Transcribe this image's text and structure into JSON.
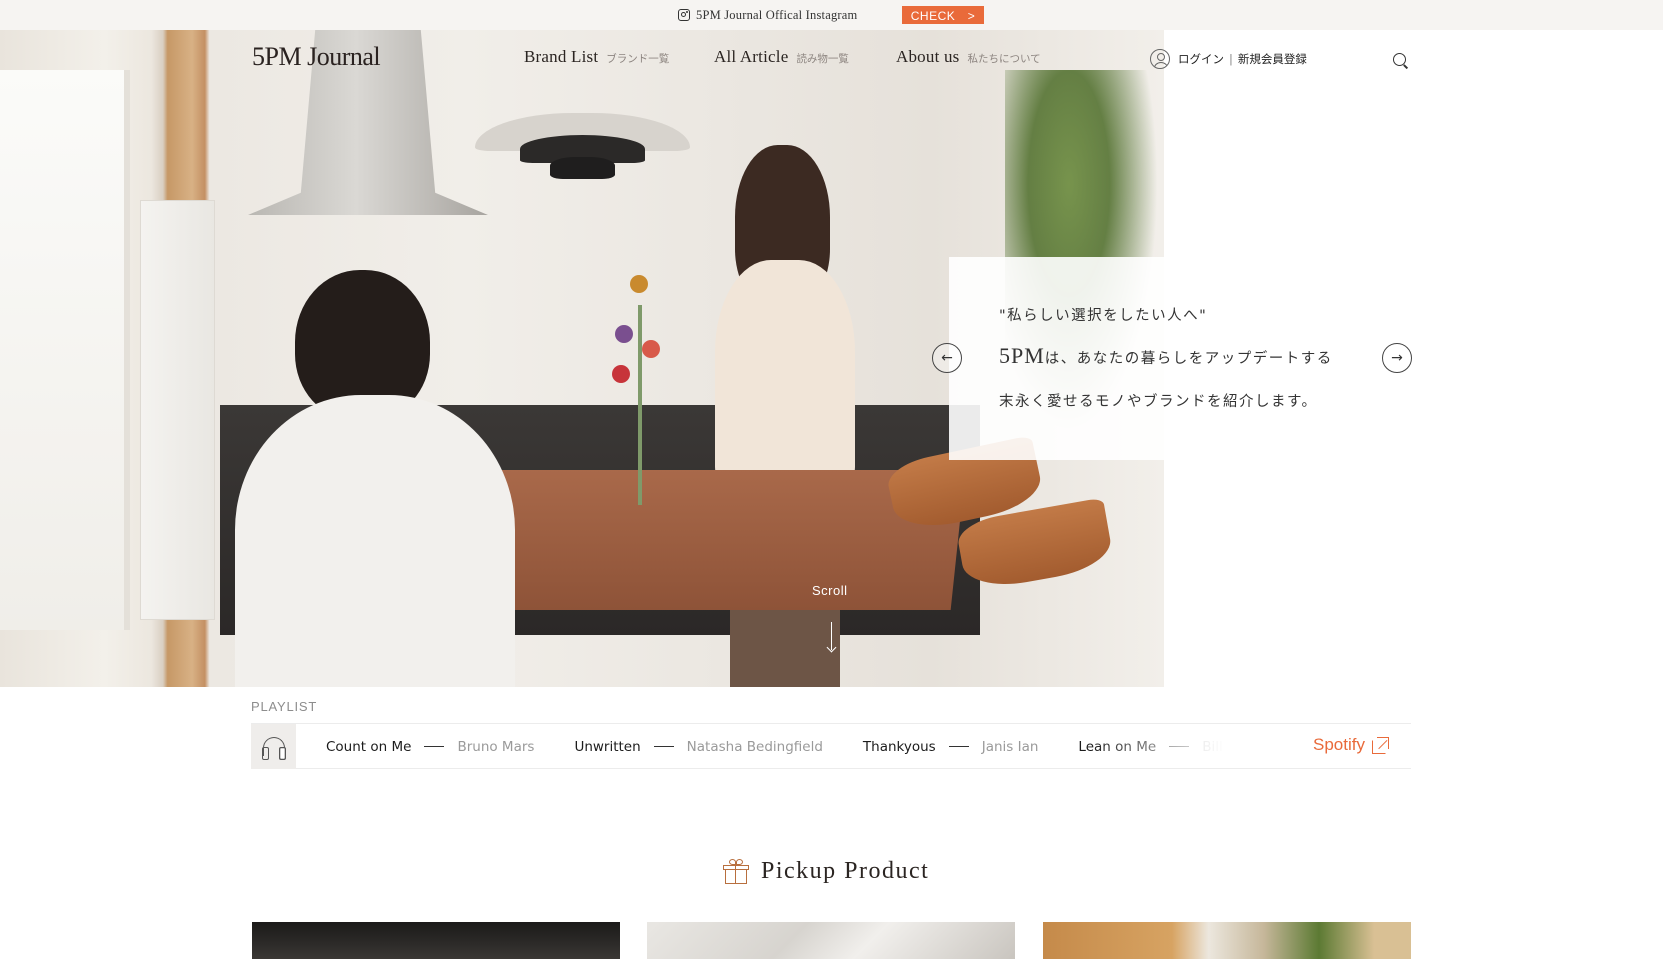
{
  "announcement": {
    "instagram_text": "5PM Journal Offical Instagram",
    "check_label": "CHECK　>",
    "check_color": "#e96a3a"
  },
  "header": {
    "logo": "5PM Journal",
    "nav": [
      {
        "en": "Brand List",
        "jp": "ブランド一覧"
      },
      {
        "en": "All Article",
        "jp": "読み物一覧"
      },
      {
        "en": "About us",
        "jp": "私たちについて"
      }
    ],
    "login": "ログイン",
    "separator": "|",
    "register": "新規会員登録"
  },
  "hero": {
    "line1": "\"私らしい選択をしたい人へ\"",
    "line2_big": "5PM",
    "line2_rest": "は、あなたの暮らしをアップデートする",
    "line3": "末永く愛せるモノやブランドを紹介します。",
    "prev_glyph": "←",
    "next_glyph": "→",
    "scroll_label": "Scroll"
  },
  "playlist": {
    "label": "PLAYLIST",
    "tracks": [
      {
        "title": "Count on Me",
        "artist": "Bruno Mars"
      },
      {
        "title": "Unwritten",
        "artist": "Natasha Bedingfield"
      },
      {
        "title": "Thankyous",
        "artist": "Janis Ian"
      },
      {
        "title": "Lean on Me",
        "artist": "Bill Withers"
      }
    ],
    "spotify_label": "Spotify",
    "accent_color": "#e96a3a"
  },
  "pickup": {
    "title": "Pickup Product"
  }
}
